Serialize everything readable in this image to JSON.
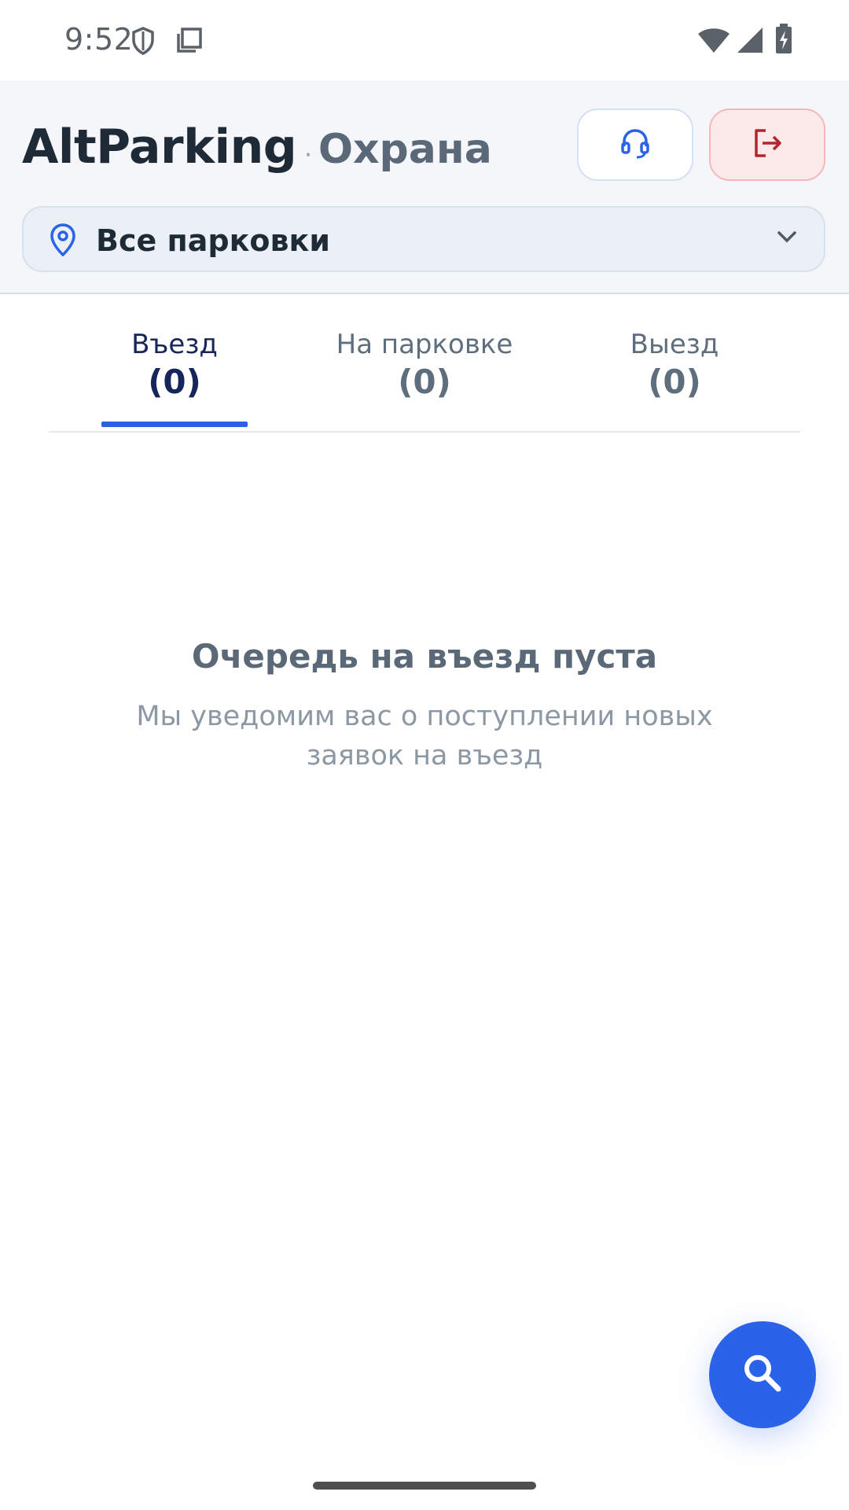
{
  "status_bar": {
    "time": "9:52",
    "icons": [
      "shield-icon",
      "copy-icon",
      "wifi-icon",
      "signal-icon",
      "battery-charging-icon"
    ]
  },
  "header": {
    "app_name": "AltParking",
    "separator": "·",
    "role": "Охрана",
    "support_icon": "headset-icon",
    "logout_icon": "logout-icon"
  },
  "parking_selector": {
    "icon": "location-pin-icon",
    "label": "Все парковки",
    "dropdown_icon": "chevron-down-icon"
  },
  "tabs": [
    {
      "label": "Въезд",
      "count": "(0)",
      "active": true
    },
    {
      "label": "На парковке",
      "count": "(0)",
      "active": false
    },
    {
      "label": "Выезд",
      "count": "(0)",
      "active": false
    }
  ],
  "empty_state": {
    "title": "Очередь на въезд пуста",
    "subtitle": "Мы уведомим вас о поступлении новых заявок на въезд"
  },
  "fab": {
    "icon": "search-icon"
  },
  "colors": {
    "accent": "#2a62e8",
    "header_bg": "#f4f6f9",
    "logout_bg": "#fce9ea",
    "logout_icon": "#b3262d",
    "tab_active": "#16265c"
  }
}
